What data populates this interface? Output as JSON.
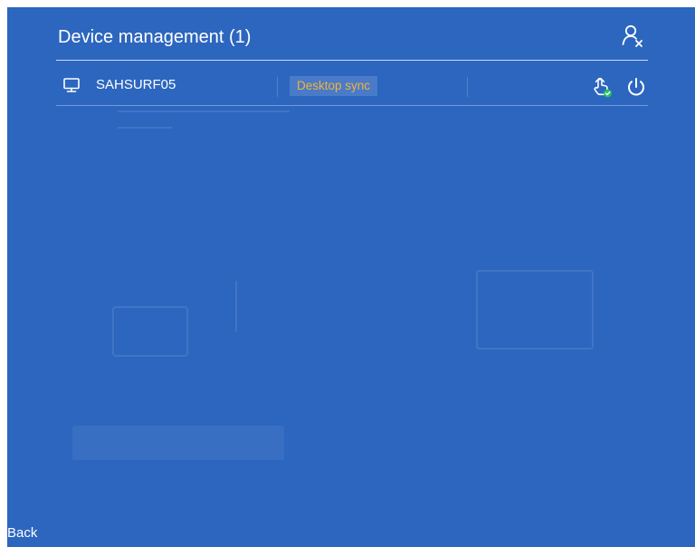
{
  "header": {
    "title": "Device management (1)",
    "account_icon": "user-remove-icon"
  },
  "devices": [
    {
      "icon": "monitor-icon",
      "name": "SAHSURF05",
      "badge": "Desktop sync",
      "action_icons": [
        "remote-control-icon",
        "power-icon"
      ]
    }
  ],
  "footer": {
    "back_label": "Back"
  },
  "colors": {
    "overlay_background": "#2c66bf",
    "badge_text": "#f5b13a",
    "status_green": "#22c55e"
  }
}
